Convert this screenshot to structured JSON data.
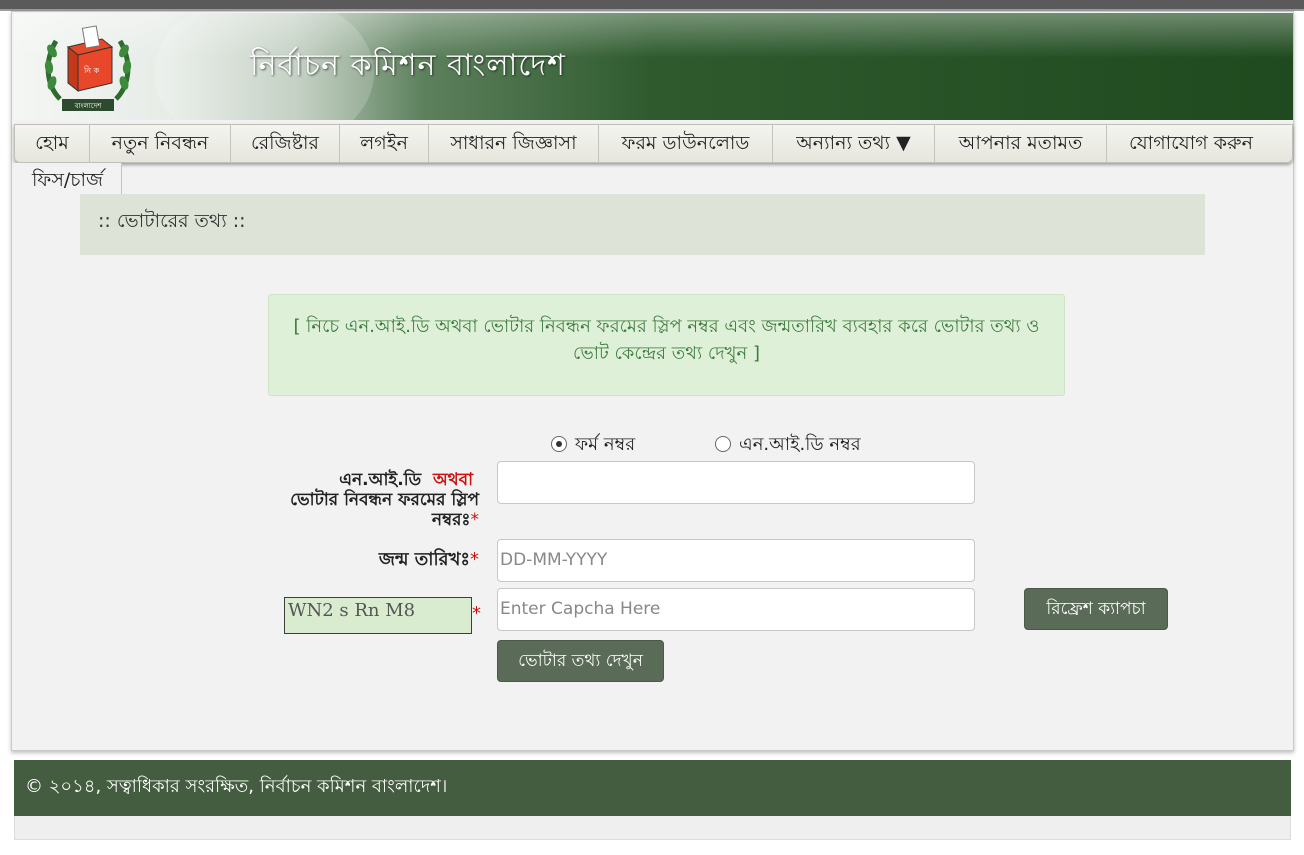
{
  "header": {
    "title": "নির্বাচন কমিশন বাংলাদেশ",
    "logo_top_text": "নি ক",
    "logo_bottom_text": "বাংলাদেশ"
  },
  "nav": {
    "items": [
      {
        "label": "হোম"
      },
      {
        "label": "নতুন নিবন্ধন"
      },
      {
        "label": "রেজিষ্টার"
      },
      {
        "label": "লগইন"
      },
      {
        "label": "সাধারন জিজ্ঞাসা"
      },
      {
        "label": "ফরম ডাউনলোড"
      },
      {
        "label": "অন্যান্য তথ্য ▼"
      },
      {
        "label": "আপনার মতামত"
      },
      {
        "label": "যোগাযোগ করুন"
      },
      {
        "label": "ফিস/চার্জ"
      }
    ]
  },
  "panel": {
    "title": ":: ভোটারের তথ্য ::",
    "notice": "[ নিচে এন.আই.ডি অথবা ভোটার নিবন্ধন ফরমের স্লিপ নম্বর এবং জন্মতারিখ ব্যবহার করে ভোটার তথ্য ও ভোট কেন্দ্রের তথ্য দেখুন ]"
  },
  "form": {
    "radio_form_label": "ফর্ম নম্বর",
    "radio_nid_label": "এন.আই.ডি নম্বর",
    "selected_radio": "ফর্ম নম্বর",
    "id_label_part1": "এন.আই.ডি",
    "id_label_or": "অথবা",
    "id_label_part2": "ভোটার নিবন্ধন ফরমের স্লিপ",
    "id_label_part3": "নম্বরঃ",
    "required_mark": "*",
    "id_value": "",
    "dob_label": "জন্ম তারিখঃ",
    "dob_placeholder": "DD-MM-YYYY",
    "captcha_text": "WN2 s Rn M8",
    "captcha_placeholder": "Enter Capcha Here",
    "refresh_button": "রিফ্রেশ ক্যাপচা",
    "submit_button": "ভোটার তথ্য দেখুন"
  },
  "footer": {
    "text": "© ২০১৪, সত্বাধিকার সংরক্ষিত, নির্বাচন কমিশন বাংলাদেশ।"
  },
  "colors": {
    "header_dark": "#1f4a1f",
    "button": "#5a6b57",
    "footer": "#445c3f",
    "notice_bg": "#dff0d8",
    "notice_text": "#3d7a3d",
    "required": "#cc1111"
  }
}
